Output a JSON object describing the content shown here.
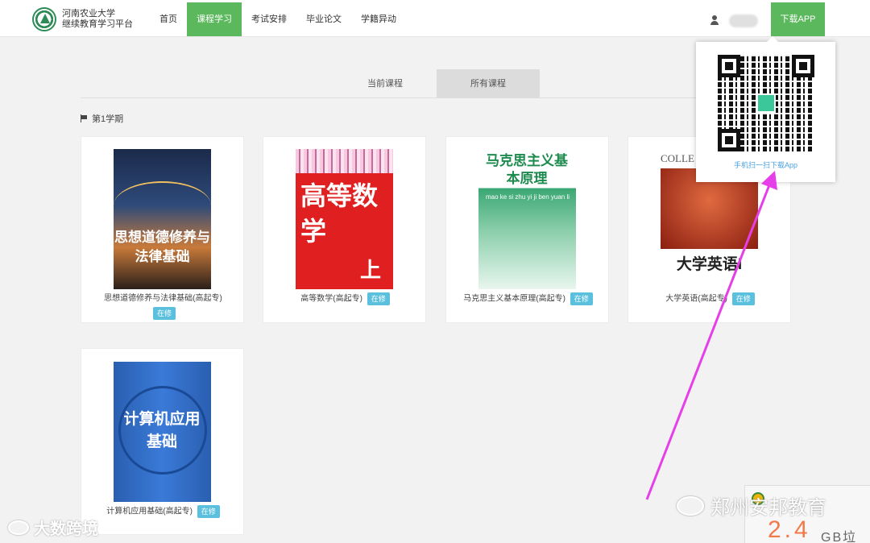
{
  "header": {
    "brand_line1": "河南农业大学",
    "brand_line2": "继续教育学习平台",
    "nav": [
      "首页",
      "课程学习",
      "考试安排",
      "毕业论文",
      "学籍异动"
    ],
    "active_nav": "课程学习",
    "download_label": "下载APP"
  },
  "tabs": [
    "当前课程",
    "所有课程"
  ],
  "active_tab": "所有课程",
  "semester": "第1学期",
  "courses": [
    {
      "title": "思想道德修养与法律基础(高起专)",
      "status": "在修",
      "cover_text": "思想道德修养与法律基础"
    },
    {
      "title": "高等数学(高起专)",
      "status": "在修",
      "cover_text": "高等数学",
      "cover_sub": "上"
    },
    {
      "title": "马克思主义基本原理(高起专)",
      "status": "在修",
      "cover_text": "马克思主义基本原理",
      "cover_pinyin": "mao ke si zhu yi ji ben yuan li"
    },
    {
      "title": "大学英语(高起专)",
      "status": "在修",
      "cover_text": "大学英语I",
      "cover_top": "COLLE"
    },
    {
      "title": "计算机应用基础(高起专)",
      "status": "在修",
      "cover_text": "计算机应用基础"
    }
  ],
  "qr_popup": {
    "caption": "手机扫一扫下载App"
  },
  "watermarks": {
    "left": "大数跨境",
    "right": "郑州安邦教育"
  },
  "widget": {
    "value": "2.4",
    "unit": "GB垃圾"
  },
  "colors": {
    "accent_green": "#5cb85c",
    "badge_blue": "#5bc0de",
    "annotation_arrow": "#e63ee8"
  }
}
